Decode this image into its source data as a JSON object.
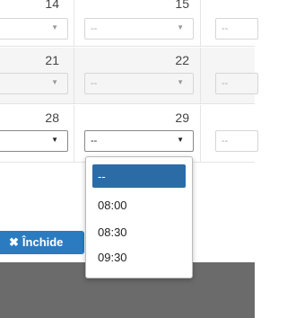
{
  "calendar": {
    "weeks": [
      {
        "days": [
          {
            "num": "14",
            "value": ""
          },
          {
            "num": "15",
            "value": "--"
          },
          {
            "value": "--"
          }
        ]
      },
      {
        "days": [
          {
            "num": "21",
            "value": ""
          },
          {
            "num": "22",
            "value": "--"
          },
          {
            "value": "--"
          }
        ]
      },
      {
        "days": [
          {
            "num": "28",
            "value": ""
          },
          {
            "num": "29",
            "value": "--"
          },
          {
            "value": "--"
          }
        ]
      }
    ]
  },
  "close_button": {
    "icon": "✖",
    "label": "Închide"
  },
  "dropdown": {
    "options": [
      "--",
      "08:00",
      "08:30",
      "09:30"
    ],
    "selected_index": 0
  },
  "colors": {
    "accent": "#2b7bc1",
    "selected": "#2b6ca7",
    "footer": "#6b6b6b"
  }
}
